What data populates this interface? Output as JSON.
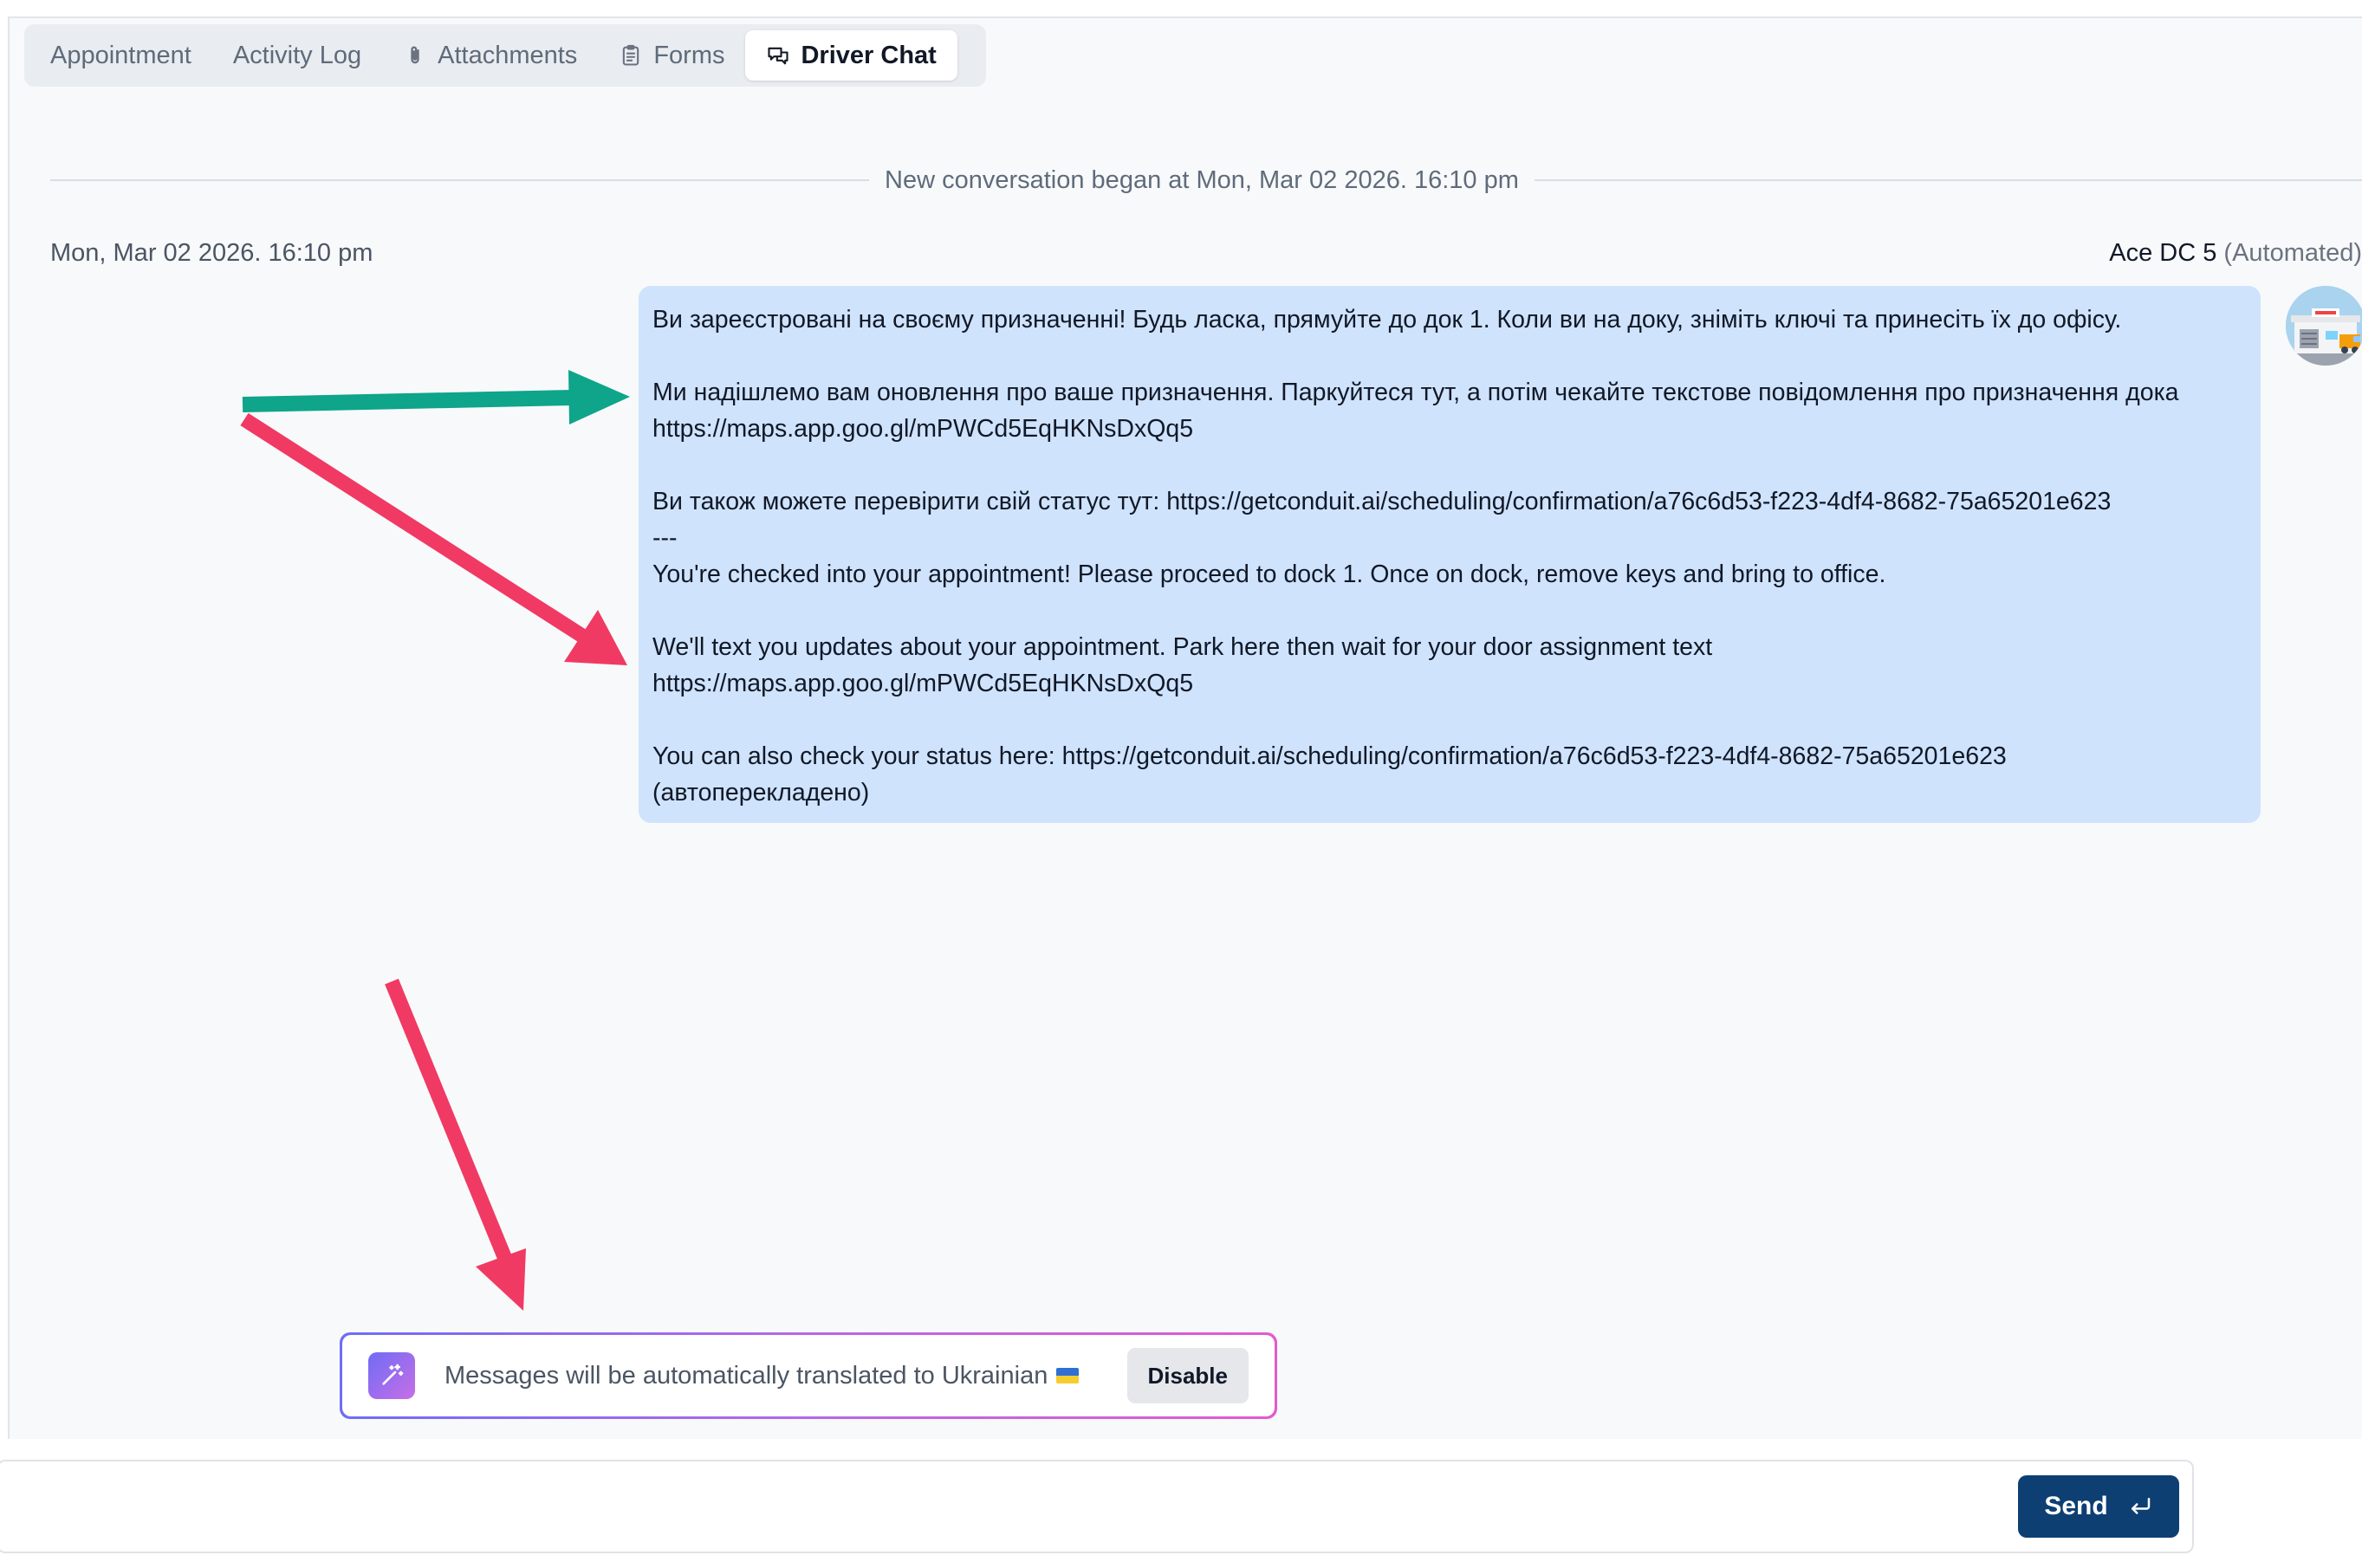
{
  "tabs": [
    {
      "label": "Appointment",
      "icon": "",
      "active": false
    },
    {
      "label": "Activity Log",
      "icon": "",
      "active": false
    },
    {
      "label": "Attachments",
      "icon": "paperclip-icon",
      "active": false
    },
    {
      "label": "Forms",
      "icon": "clipboard-icon",
      "active": false
    },
    {
      "label": "Driver Chat",
      "icon": "chat-bubbles-icon",
      "active": true
    }
  ],
  "conversation": {
    "started_text": "New conversation began at Mon, Mar 02 2026. 16:10 pm"
  },
  "message": {
    "timestamp": "Mon, Mar 02 2026. 16:10 pm",
    "sender_name": "Ace DC 5",
    "sender_tag": "(Automated)",
    "body": "Ви зареєстровані на своєму призначенні! Будь ласка, прямуйте до док 1. Коли ви на доку, зніміть ключі та принесіть їх до офісу.\n\nМи надішлемо вам оновлення про ваше призначення. Паркуйтеся тут, а потім чекайте текстове повідомлення про призначення дока\nhttps://maps.app.goo.gl/mPWCd5EqHKNsDxQq5\n\nВи також можете перевірити свій статус тут: https://getconduit.ai/scheduling/confirmation/a76c6d53-f223-4df4-8682-75a65201e623\n---\nYou're checked into your appointment! Please proceed to dock 1. Once on dock, remove keys and bring to office.\n\nWe'll text you updates about your appointment. Park here then wait for your door assignment text\nhttps://maps.app.goo.gl/mPWCd5EqHKNsDxQq5\n\nYou can also check your status here: https://getconduit.ai/scheduling/confirmation/a76c6d53-f223-4df4-8682-75a65201e623\n(автоперекладено)"
  },
  "translation_banner": {
    "text": "Messages will be automatically translated to Ukrainian",
    "flag": "Ukraine flag",
    "disable_label": "Disable"
  },
  "composer": {
    "placeholder": "",
    "value": "",
    "send_label": "Send"
  },
  "colors": {
    "bubble": "#cfe3fc",
    "send_button": "#0d3f73",
    "arrow_green": "#0ea58a",
    "arrow_red": "#f03a63"
  }
}
